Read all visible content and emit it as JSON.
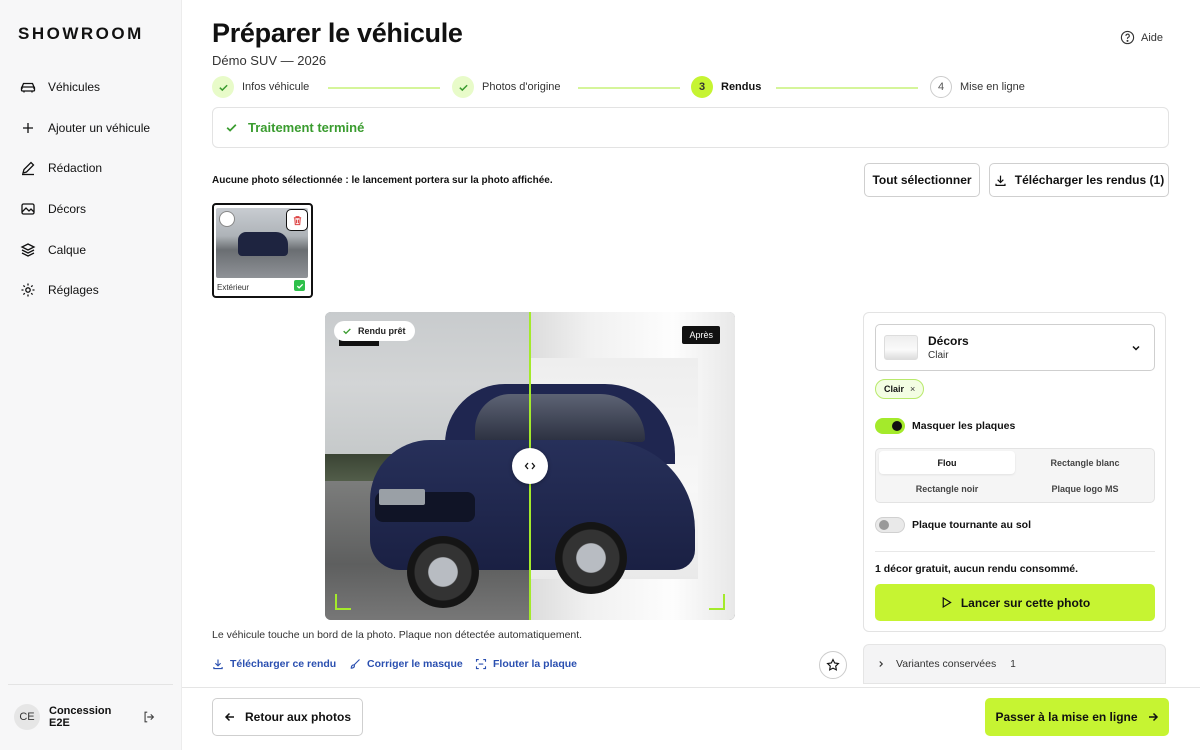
{
  "app": {
    "brand": "SHOWROOM"
  },
  "sidebar": {
    "items": [
      {
        "label": "Véhicules",
        "icon": "car-icon"
      },
      {
        "label": "Ajouter un véhicule",
        "icon": "plus-icon"
      },
      {
        "label": "Rédaction",
        "icon": "pen-icon"
      },
      {
        "label": "Décors",
        "icon": "image-icon"
      },
      {
        "label": "Calque",
        "icon": "layers-icon"
      },
      {
        "label": "Réglages",
        "icon": "gear-icon"
      }
    ],
    "user": {
      "initials": "CE",
      "name": "Concession E2E"
    }
  },
  "header": {
    "title": "Préparer le véhicule",
    "subtitle": "Démo SUV — 2026",
    "help_label": "Aide"
  },
  "stepper": {
    "steps": [
      {
        "label": "Infos véhicule",
        "state": "done",
        "number": ""
      },
      {
        "label": "Photos d'origine",
        "state": "done",
        "number": ""
      },
      {
        "label": "Rendus",
        "state": "current",
        "number": "3"
      },
      {
        "label": "Mise en ligne",
        "state": "todo",
        "number": "4"
      }
    ]
  },
  "banner": {
    "text": "Traitement terminé",
    "color": "#3a9c2f"
  },
  "selection": {
    "info": "Aucune photo sélectionnée : le lancement portera sur la photo affichée.",
    "select_all": "Tout sélectionner",
    "download_renders": "Télécharger les rendus (1)"
  },
  "thumbnails": [
    {
      "label": "Extérieur",
      "rendered": true
    }
  ],
  "viewer": {
    "status": "Rendu prêt",
    "after_label": "Après",
    "caption": "Le véhicule touche un bord de la photo. Plaque non détectée automatiquement.",
    "accent": "#a4ea2b"
  },
  "actions": {
    "download": "Télécharger ce rendu",
    "fix_mask": "Corriger le masque",
    "blur_plate": "Flouter la plaque"
  },
  "panel": {
    "decor": {
      "title": "Décors",
      "value": "Clair"
    },
    "chips": [
      {
        "label": "Clair"
      }
    ],
    "mask_plates": {
      "label": "Masquer les plaques",
      "on": true
    },
    "plate_options": [
      {
        "label": "Flou",
        "selected": true
      },
      {
        "label": "Rectangle blanc",
        "selected": false
      },
      {
        "label": "Rectangle noir",
        "selected": false
      },
      {
        "label": "Plaque logo MS",
        "selected": false
      }
    ],
    "turntable": {
      "label": "Plaque tournante au sol",
      "on": false
    },
    "credit": "1 décor gratuit, aucun rendu consommé.",
    "launch": "Lancer sur cette photo",
    "accent": "#c6f432"
  },
  "variants": {
    "label": "Variantes conservées",
    "count": "1"
  },
  "footer": {
    "back": "Retour aux photos",
    "next": "Passer à la mise en ligne"
  }
}
